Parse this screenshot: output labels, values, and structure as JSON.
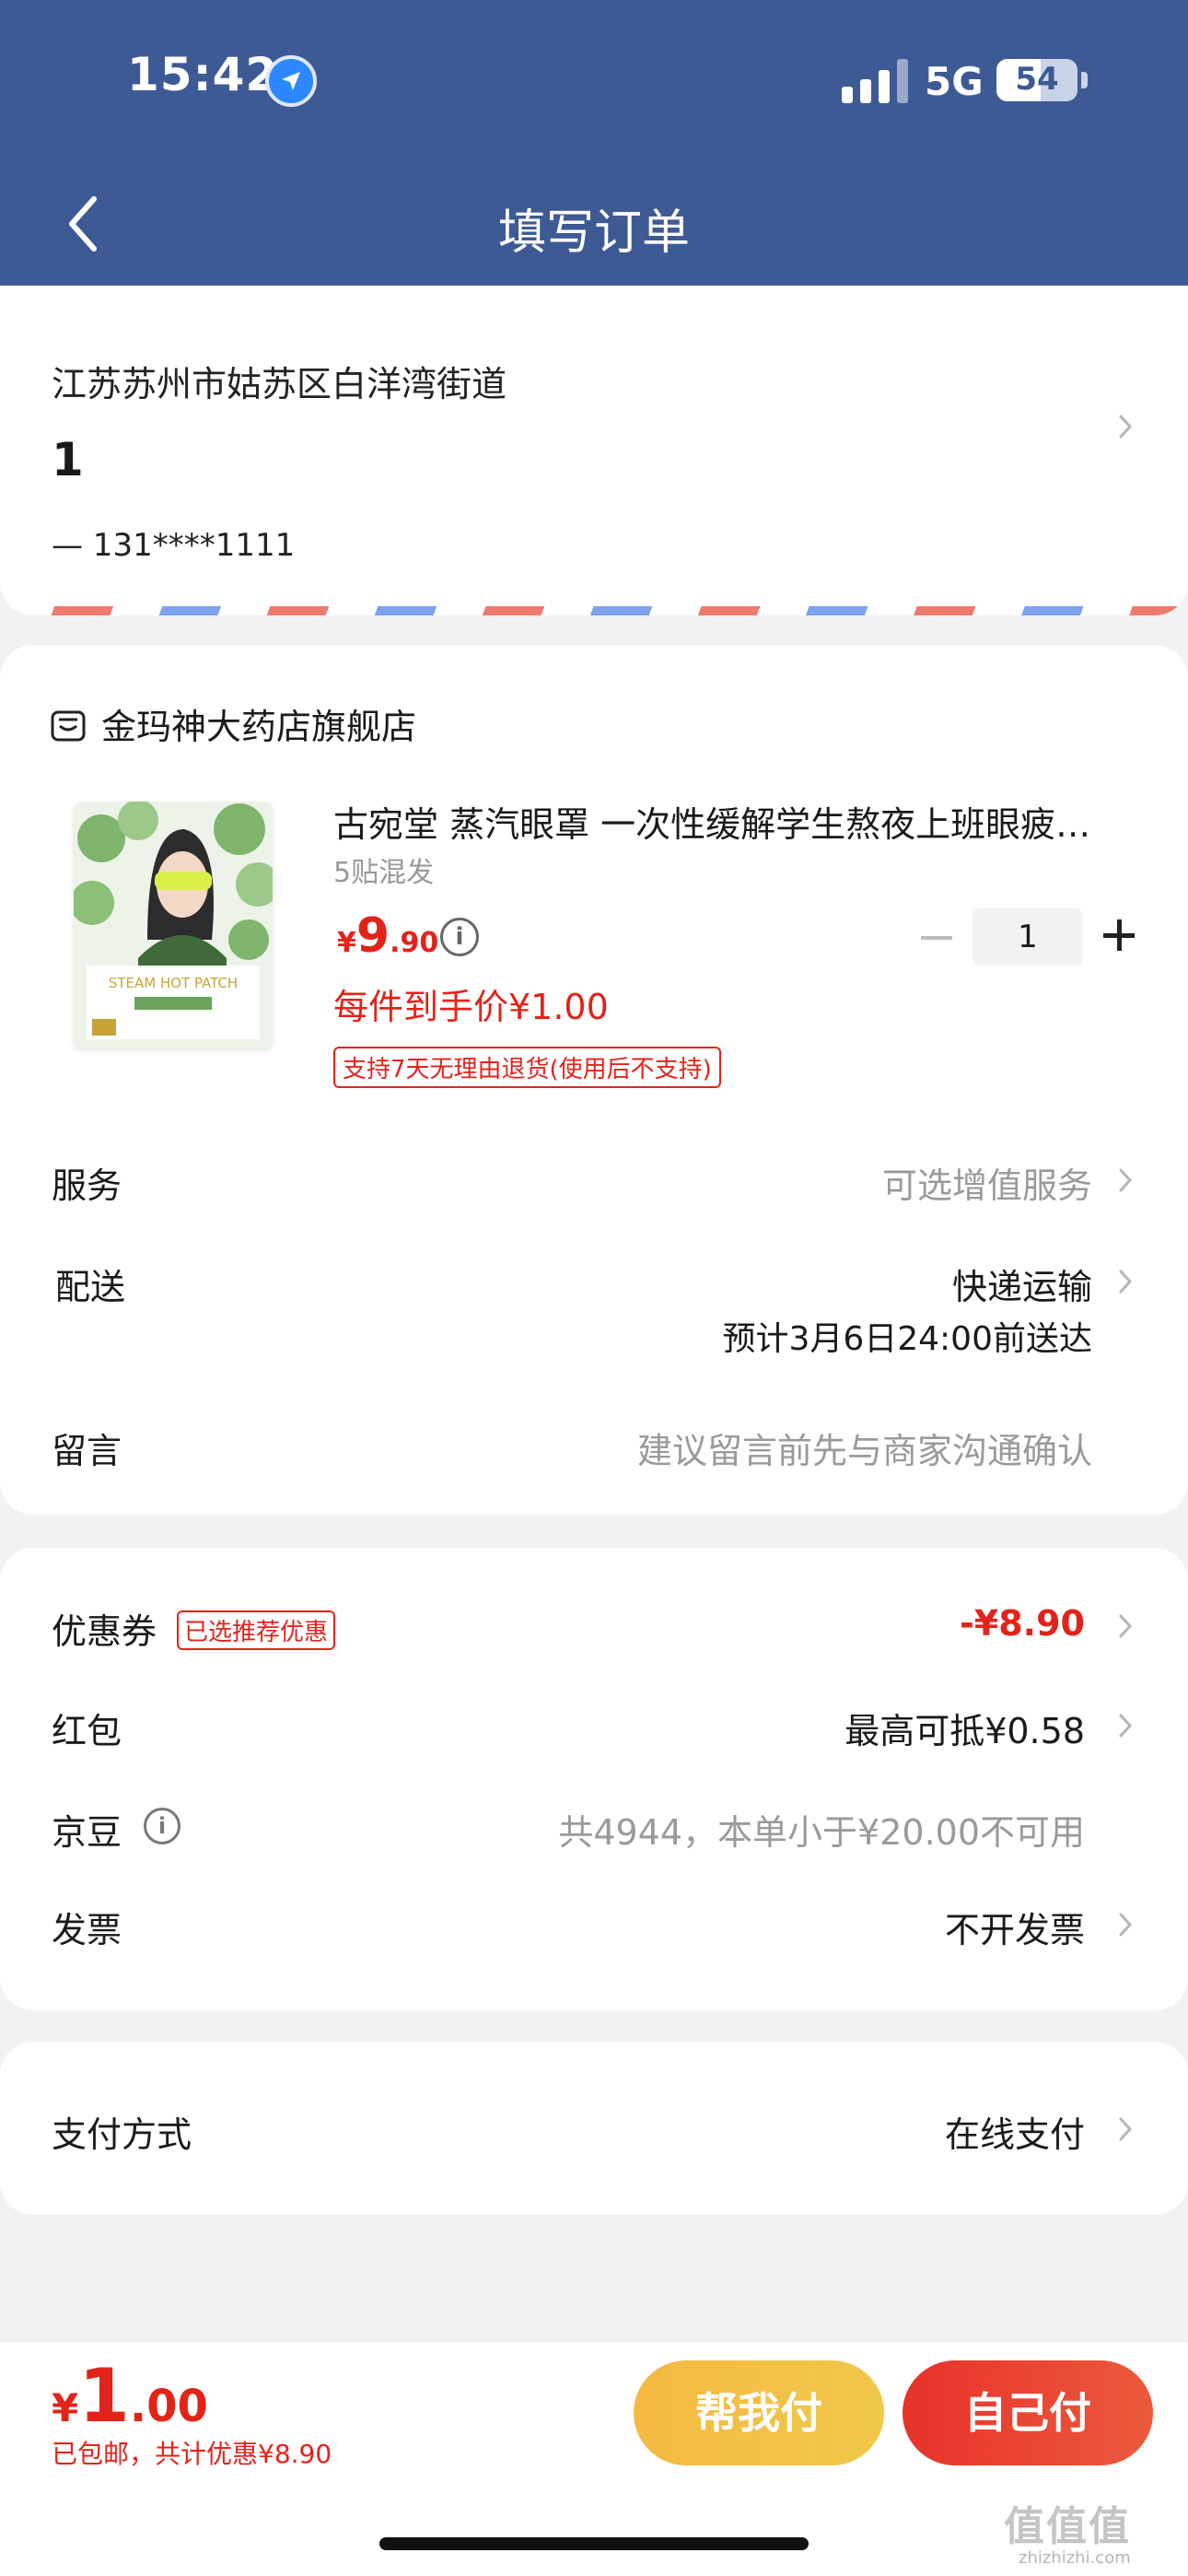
{
  "status_bar": {
    "time": "15:42",
    "network": "5G",
    "battery": "54",
    "battery_level": 0.54
  },
  "header": {
    "title": "填写订单"
  },
  "address": {
    "line": "江苏苏州市姑苏区白洋湾街道",
    "name": "1",
    "phone": "—  131****1111"
  },
  "store": {
    "name": "金玛神大药店旗舰店"
  },
  "product": {
    "title": "古宛堂 蒸汽眼罩 一次性缓解学生熬夜上班眼疲…",
    "spec": "5贴混发",
    "price_symbol": "¥",
    "price_int": "9",
    "price_dec": ".90",
    "info": "i",
    "unit_price": "每件到手价¥1.00",
    "return_tag": "支持7天无理由退货(使用后不支持)",
    "quantity": "1"
  },
  "rows": {
    "service": {
      "label": "服务",
      "value": "可选增值服务"
    },
    "delivery": {
      "label": "配送",
      "value": "快递运输",
      "eta": "预计3月6日24:00前送达"
    },
    "message": {
      "label": "留言",
      "placeholder": "建议留言前先与商家沟通确认"
    }
  },
  "discounts": {
    "coupon": {
      "label": "优惠券",
      "tag": "已选推荐优惠",
      "value": "-¥8.90"
    },
    "redpacket": {
      "label": "红包",
      "value": "最高可抵¥0.58"
    },
    "beans": {
      "label": "京豆",
      "info": "i",
      "value": "共4944，本单小于¥20.00不可用"
    },
    "invoice": {
      "label": "发票",
      "value": "不开发票"
    }
  },
  "payment": {
    "label": "支付方式",
    "value": "在线支付"
  },
  "bottom": {
    "total_symbol": "¥",
    "total_int": "1",
    "total_dec": ".00",
    "note": "已包邮，共计优惠¥8.90",
    "help_pay": "帮我付",
    "self_pay": "自己付"
  },
  "watermark": {
    "text": "值值值",
    "sub": "zhizhizhi.com"
  },
  "colors": {
    "header_bg": "#3d5a94",
    "accent_red": "#e2231a",
    "help_btn": "#f5b942",
    "pay_btn": "#e8322a"
  }
}
